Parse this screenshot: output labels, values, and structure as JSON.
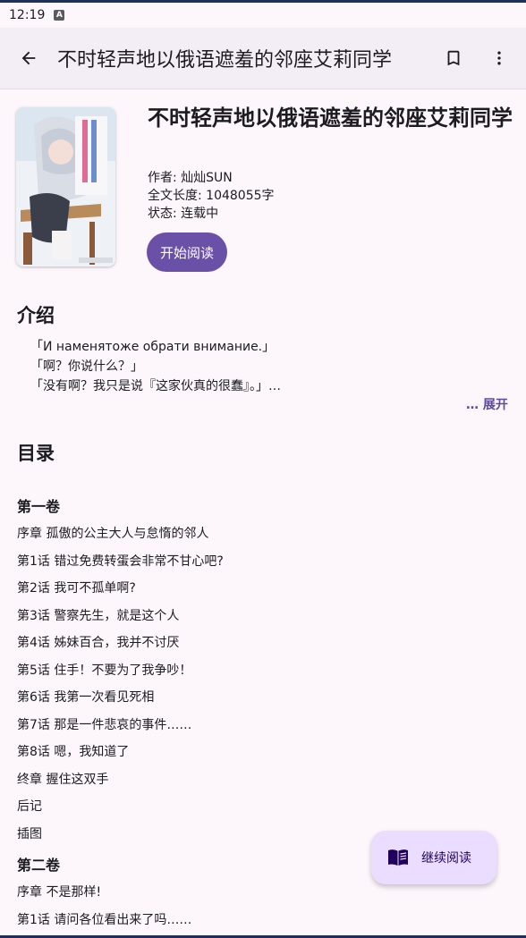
{
  "status_bar": {
    "time": "12:19",
    "indicator": "A"
  },
  "app_bar": {
    "title": "不时轻声地以俄语遮羞的邻座艾莉同学",
    "back_icon": "arrow-back-icon",
    "bookmark_icon": "bookmark-outline-icon",
    "more_icon": "more-vert-icon"
  },
  "book": {
    "title": "不时轻声地以俄语遮羞的邻座艾莉同学",
    "author": "作者: 灿灿SUN",
    "length": "全文长度: 1048055字",
    "status": "状态: 连载中",
    "start_button": "开始阅读"
  },
  "intro": {
    "heading": "介绍",
    "lines": [
      "「И наменятоже обрати внимание.」",
      "「啊？你说什么？」",
      "「没有啊？我只是说『这家伙真的很蠢』。」…"
    ],
    "expand": "… 展开"
  },
  "toc": {
    "heading": "目录",
    "volume1": {
      "title": "第一卷",
      "chapters": [
        "序章 孤傲的公主大人与怠惰的邻人",
        "第1话 错过免费转蛋会非常不甘心吧?",
        "第2话 我可不孤单啊?",
        "第3话 警察先生，就是这个人",
        "第4话 姊妹百合，我并不讨厌",
        "第5话 住手！不要为了我争吵！",
        "第6话 我第一次看见死相",
        "第7话 那是一件悲哀的事件……",
        "第8话 嗯，我知道了",
        "终章 握住这双手",
        "后记",
        "插图"
      ]
    },
    "volume2": {
      "title": "第二卷",
      "chapters": [
        "序章 不是那样!",
        "第1话 请问各位看出来了吗……"
      ]
    }
  },
  "fab": {
    "label": "继续阅读",
    "icon": "menu-book-icon"
  },
  "colors": {
    "accent": "#6a50a7",
    "fab_bg": "#eaddff",
    "app_bar_bg": "#f3edf6",
    "background": "#fdf7fc"
  }
}
